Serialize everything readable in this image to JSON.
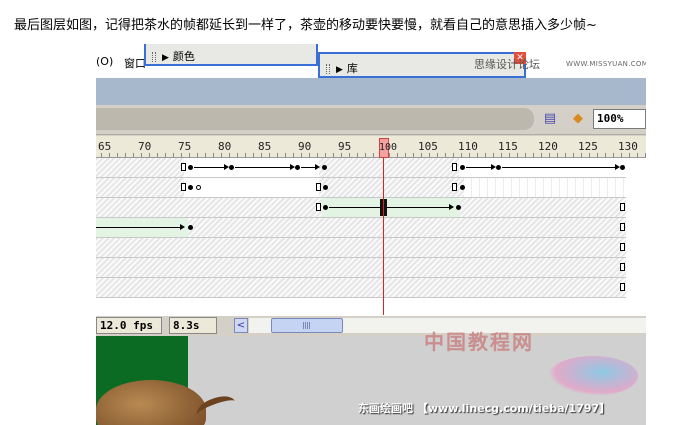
{
  "caption": "最后图层如图，记得把茶水的帧都延长到一样了，茶壶的移动要快要慢，就看自己的意思插入多少帧~",
  "menu": {
    "item_o": "(O)",
    "item_window": "窗口"
  },
  "panels": {
    "color": "颜色",
    "library": "库"
  },
  "watermarks": {
    "top": "思缘设计论坛",
    "top_url": "WWW.MISSYUAN.COM",
    "bottom_cn": "中国教程网",
    "bottom": "东画绘画吧 【www.linecg.com/tieba/1797】"
  },
  "toolbar": {
    "zoom": "100%",
    "icon_a": "edit-scene-icon",
    "icon_b": "edit-symbol-icon"
  },
  "ruler": {
    "labels": [
      "65",
      "70",
      "75",
      "80",
      "85",
      "90",
      "95",
      "100",
      "105",
      "110",
      "115",
      "120",
      "125",
      "130"
    ],
    "playhead": "100"
  },
  "status": {
    "fps": "12.0 fps",
    "time": "8.3s",
    "scroll_left": "<"
  }
}
